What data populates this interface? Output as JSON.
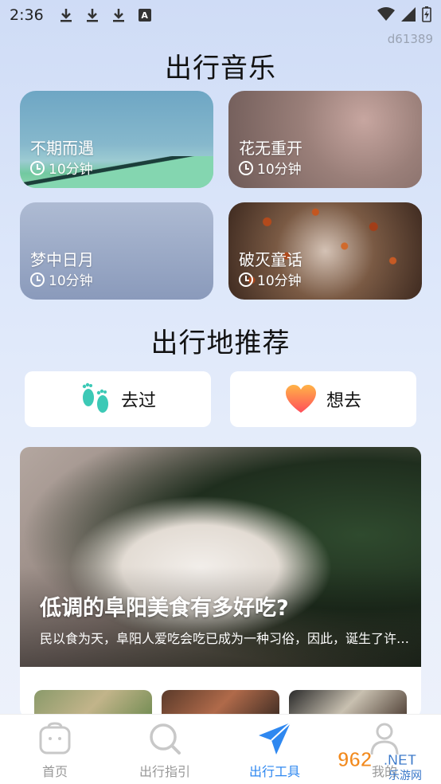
{
  "status_bar": {
    "time": "2:36",
    "device_id": "d61389"
  },
  "music_section": {
    "title": "出行音乐",
    "cards": [
      {
        "title": "不期而遇",
        "duration": "10分钟"
      },
      {
        "title": "花无重开",
        "duration": "10分钟"
      },
      {
        "title": "梦中日月",
        "duration": "10分钟"
      },
      {
        "title": "破灭童话",
        "duration": "10分钟"
      }
    ]
  },
  "destination_section": {
    "title": "出行地推荐",
    "buttons": [
      {
        "label": "去过",
        "icon": "footprints-icon"
      },
      {
        "label": "想去",
        "icon": "heart-icon"
      }
    ]
  },
  "feature_article": {
    "title": "低调的阜阳美食有多好吃?",
    "description": "民以食为天，阜阳人爱吃会吃已成为一种习俗，因此，诞生了许多美食"
  },
  "tab_bar": {
    "tabs": [
      {
        "label": "首页",
        "icon": "home-icon"
      },
      {
        "label": "出行指引",
        "icon": "search-icon"
      },
      {
        "label": "出行工具",
        "icon": "paper-plane-icon",
        "active": true
      },
      {
        "label": "我的",
        "icon": "user-icon"
      }
    ]
  },
  "watermark": {
    "text": "962.NET",
    "subtext": "乐游网"
  },
  "colors": {
    "accent": "#2f88f0",
    "inactive": "#999999"
  }
}
